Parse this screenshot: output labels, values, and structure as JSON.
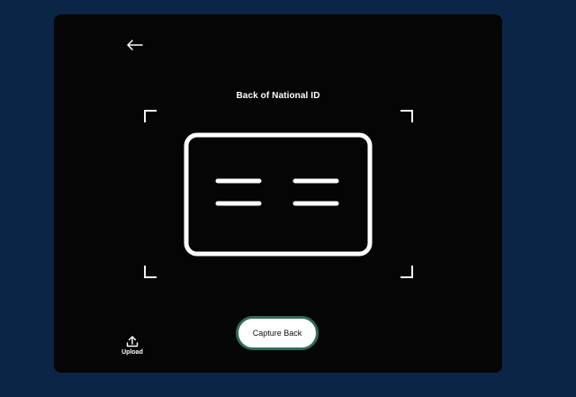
{
  "header": {
    "back_icon": "arrow-left-icon",
    "title": "Back of National ID"
  },
  "actions": {
    "capture_label": "Capture Back",
    "upload_label": "Upload",
    "upload_icon": "upload-icon"
  },
  "colors": {
    "page_background": "#0b2547",
    "panel_background": "#050505",
    "capture_border": "#2f6b59",
    "foreground": "#ffffff"
  }
}
